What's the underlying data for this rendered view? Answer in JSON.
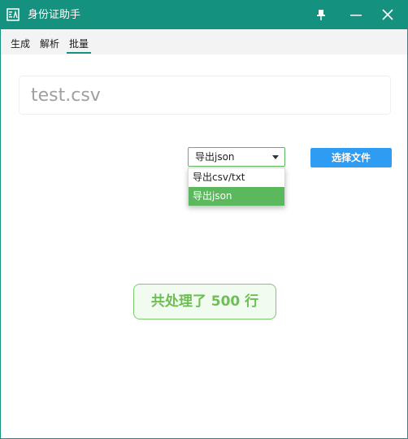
{
  "window": {
    "title": "身份证助手",
    "icons": {
      "app": "app-id-icon",
      "pin": "pin-icon",
      "minimize": "minimize-icon",
      "close": "close-icon"
    }
  },
  "menu": {
    "tabs": [
      {
        "label": "生成"
      },
      {
        "label": "解析"
      },
      {
        "label": "批量",
        "active": true
      }
    ]
  },
  "main": {
    "file_name": "test.csv",
    "export_select": {
      "value": "导出json",
      "options": [
        "导出csv/txt",
        "导出json"
      ],
      "highlighted_index": 1
    },
    "choose_file_label": "选择文件",
    "result_text": "共处理了 500 行"
  },
  "colors": {
    "titlebar": "#15927f",
    "accent_green": "#5cb85c",
    "button_blue": "#2d9cf2",
    "result_text": "#6cbf52",
    "result_bg": "#f2fbf0",
    "result_border": "#7dcc70"
  }
}
